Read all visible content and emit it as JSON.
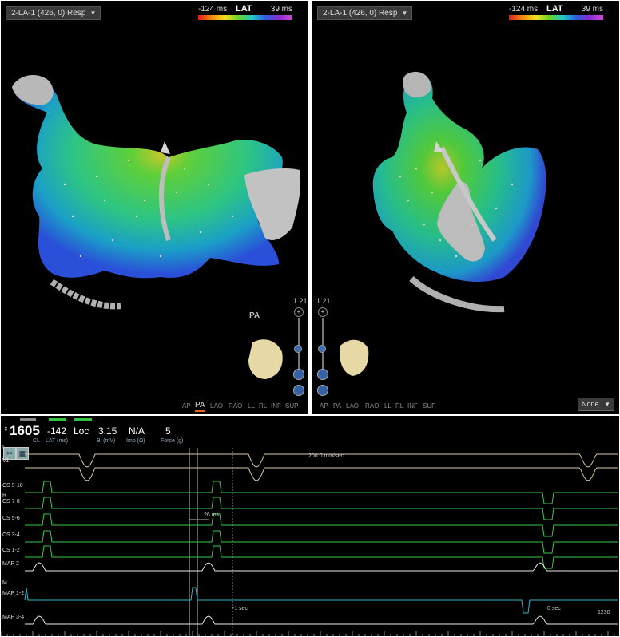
{
  "maps": [
    {
      "dropdown": "2-LA-1 (426, 0) Resp",
      "lat_min": "-124 ms",
      "lat_title": "LAT",
      "lat_max": "39 ms",
      "zoom": "1.21",
      "orientation": "PA",
      "views": [
        "AP",
        "PA",
        "LAO",
        "RAO",
        "LL",
        "RL",
        "INF",
        "SUP"
      ],
      "active_view": "PA"
    },
    {
      "dropdown": "2-LA-1 (426, 0) Resp",
      "lat_min": "-124 ms",
      "lat_title": "LAT",
      "lat_max": "39 ms",
      "zoom": "1.21",
      "views": [
        "AP",
        "PA",
        "LAO",
        "RAO",
        "LL",
        "RL",
        "INF",
        "SUP"
      ],
      "active_view": "",
      "display_select": "None"
    }
  ],
  "status": {
    "cl_value": "1605",
    "cl_label": "CL",
    "lat_value": "-142",
    "lat_label": "LAT (ms)",
    "loc_label": "Loc",
    "bi_value": "3.15",
    "bi_label": "Bi (mV)",
    "imp_value": "N/A",
    "imp_label": "Imp (Ω)",
    "force_value": "5",
    "force_label": "Force (g)"
  },
  "channels": [
    "I",
    "V1",
    "CS 9-10",
    "R",
    "CS 7-8",
    "CS 5-6",
    "CS 3-4",
    "CS 1-2",
    "MAP 2",
    "M",
    "MAP 1-2",
    "MAP 3-4"
  ],
  "annotations": {
    "sweep_speed": "200.0 mm/sec",
    "interval": "26 ms",
    "time_marker_left": "-1 sec",
    "time_marker_right": "0 sec",
    "corner_value": "1230"
  },
  "colors": {
    "surface": "#ffffff",
    "catheter_trace": "#d8c8a8",
    "cs_trace": "#3dc84a",
    "map_trace": "#e8e8e8",
    "abl_trace": "#35b7cc",
    "accent": "#e0642a"
  },
  "icons": [
    "caliper-icon",
    "grid-icon",
    "spin-icon"
  ]
}
